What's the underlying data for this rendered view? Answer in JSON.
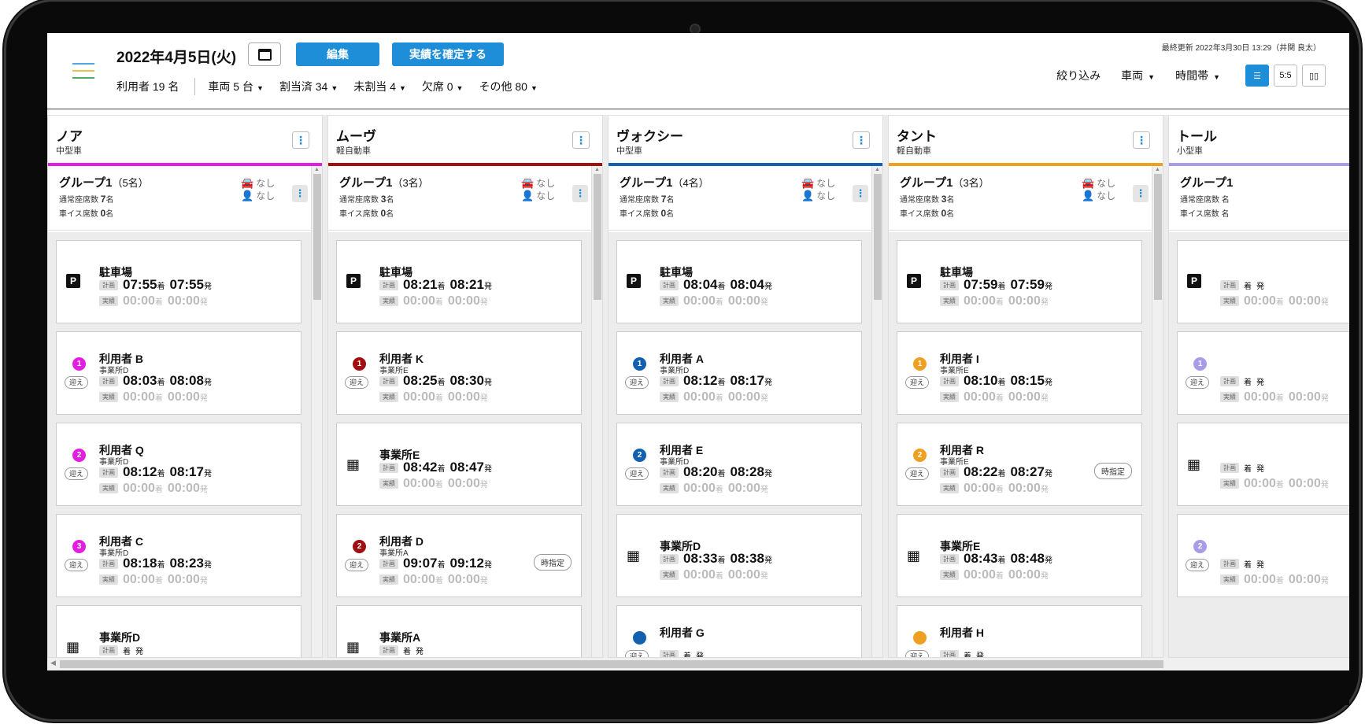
{
  "header": {
    "date": "2022年4月5日(火)",
    "edit_label": "編集",
    "confirm_label": "実績を確定する",
    "last_updated": "最終更新 2022年3月30日 13:29（井関 良太）",
    "stats": {
      "users": "利用者 19 名",
      "vehicles": "車両 5 台",
      "assigned": "割当済 34",
      "unassigned": "未割当 4",
      "absent": "欠席 0",
      "other": "その他 80"
    },
    "filter_label": "絞り込み",
    "filter_vehicle": "車両",
    "filter_timeslot": "時間帯",
    "view_list": "☰",
    "view_split": "5:5",
    "view_map": "▯▯"
  },
  "common": {
    "plan_tag": "計画",
    "actual_tag": "実績",
    "arrive": "着",
    "depart": "発",
    "pickup": "迎え",
    "fixed": "時指定",
    "seat_normal": "通常座席数",
    "seat_wheel": "車イス席数",
    "unit_person": "名",
    "none": "なし",
    "empty_time": "00:00"
  },
  "columns": [
    {
      "name": "ノア",
      "type": "中型車",
      "color": "#e21fe0",
      "group": {
        "title": "グループ1",
        "count": "（5名）",
        "normal": "7",
        "wheel": "0"
      },
      "stops": [
        {
          "kind": "parking",
          "name": "駐車場",
          "plan_a": "07:55",
          "plan_d": "07:55"
        },
        {
          "kind": "user",
          "name": "利用者 B",
          "sub": "事業所D",
          "num": "1",
          "plan_a": "08:03",
          "plan_d": "08:08"
        },
        {
          "kind": "user",
          "name": "利用者 Q",
          "sub": "事業所D",
          "num": "2",
          "plan_a": "08:12",
          "plan_d": "08:17"
        },
        {
          "kind": "user",
          "name": "利用者 C",
          "sub": "事業所D",
          "num": "3",
          "plan_a": "08:18",
          "plan_d": "08:23"
        },
        {
          "kind": "office",
          "name": "事業所D",
          "plan_a": "",
          "plan_d": ""
        }
      ]
    },
    {
      "name": "ムーヴ",
      "type": "軽自動車",
      "color": "#a01010",
      "group": {
        "title": "グループ1",
        "count": "（3名）",
        "normal": "3",
        "wheel": "0"
      },
      "stops": [
        {
          "kind": "parking",
          "name": "駐車場",
          "plan_a": "08:21",
          "plan_d": "08:21"
        },
        {
          "kind": "user",
          "name": "利用者 K",
          "sub": "事業所E",
          "num": "1",
          "plan_a": "08:25",
          "plan_d": "08:30"
        },
        {
          "kind": "office",
          "name": "事業所E",
          "plan_a": "08:42",
          "plan_d": "08:47"
        },
        {
          "kind": "user",
          "name": "利用者 D",
          "sub": "事業所A",
          "num": "2",
          "plan_a": "09:07",
          "plan_d": "09:12",
          "fixed": true
        },
        {
          "kind": "office",
          "name": "事業所A",
          "plan_a": "",
          "plan_d": ""
        }
      ]
    },
    {
      "name": "ヴォクシー",
      "type": "中型車",
      "color": "#1460b0",
      "group": {
        "title": "グループ1",
        "count": "（4名）",
        "normal": "7",
        "wheel": "0"
      },
      "stops": [
        {
          "kind": "parking",
          "name": "駐車場",
          "plan_a": "08:04",
          "plan_d": "08:04"
        },
        {
          "kind": "user",
          "name": "利用者 A",
          "sub": "事業所D",
          "num": "1",
          "plan_a": "08:12",
          "plan_d": "08:17"
        },
        {
          "kind": "user",
          "name": "利用者 E",
          "sub": "事業所D",
          "num": "2",
          "plan_a": "08:20",
          "plan_d": "08:28"
        },
        {
          "kind": "office",
          "name": "事業所D",
          "plan_a": "08:33",
          "plan_d": "08:38"
        },
        {
          "kind": "user",
          "name": "利用者 G",
          "sub": "",
          "num": "",
          "plan_a": "",
          "plan_d": ""
        }
      ]
    },
    {
      "name": "タント",
      "type": "軽自動車",
      "color": "#f0a020",
      "group": {
        "title": "グループ1",
        "count": "（3名）",
        "normal": "3",
        "wheel": "0"
      },
      "stops": [
        {
          "kind": "parking",
          "name": "駐車場",
          "plan_a": "07:59",
          "plan_d": "07:59"
        },
        {
          "kind": "user",
          "name": "利用者 I",
          "sub": "事業所E",
          "num": "1",
          "plan_a": "08:10",
          "plan_d": "08:15"
        },
        {
          "kind": "user",
          "name": "利用者 R",
          "sub": "事業所E",
          "num": "2",
          "plan_a": "08:22",
          "plan_d": "08:27",
          "fixed": true
        },
        {
          "kind": "office",
          "name": "事業所E",
          "plan_a": "08:43",
          "plan_d": "08:48"
        },
        {
          "kind": "user",
          "name": "利用者 H",
          "sub": "",
          "num": "",
          "plan_a": "",
          "plan_d": ""
        }
      ]
    },
    {
      "name": "トール",
      "type": "小型車",
      "color": "#a89be8",
      "group": {
        "title": "グループ1",
        "count": "",
        "normal": "",
        "wheel": ""
      },
      "stops": [
        {
          "kind": "parking",
          "name": "",
          "plan_a": "",
          "plan_d": ""
        },
        {
          "kind": "user",
          "name": "",
          "sub": "",
          "num": "1",
          "plan_a": "",
          "plan_d": ""
        },
        {
          "kind": "office",
          "name": "",
          "plan_a": "",
          "plan_d": ""
        },
        {
          "kind": "user",
          "name": "",
          "sub": "",
          "num": "2",
          "plan_a": "",
          "plan_d": ""
        }
      ]
    }
  ]
}
